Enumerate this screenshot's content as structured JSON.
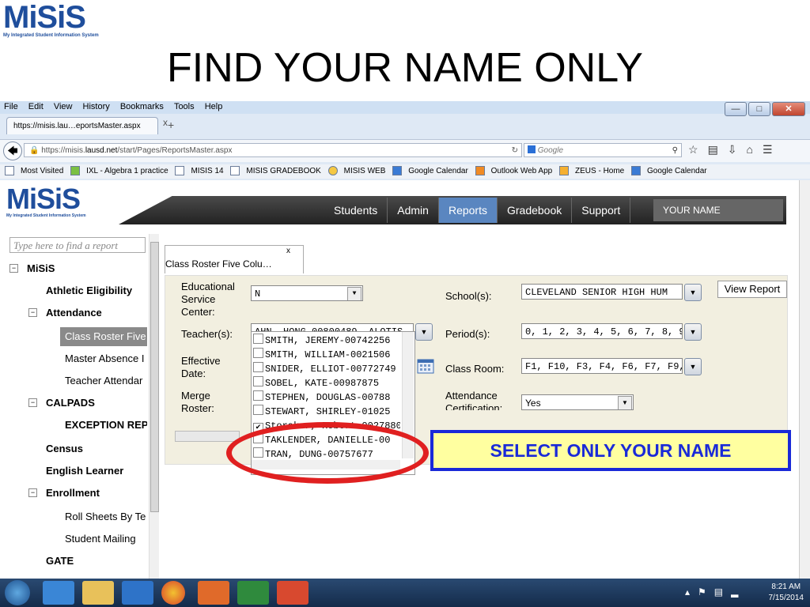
{
  "slide": {
    "logo_word": "MiSiS",
    "logo_subtitle": "My Integrated Student Information System",
    "title": "FIND YOUR NAME ONLY"
  },
  "browser": {
    "menu": [
      "File",
      "Edit",
      "View",
      "History",
      "Bookmarks",
      "Tools",
      "Help"
    ],
    "tab_title": "https://misis.lau…eportsMaster.aspx",
    "tab_close": "x",
    "new_tab": "+",
    "url_prefix": "https://misis.",
    "url_domain": "lausd.net",
    "url_path": "/start/Pages/ReportsMaster.aspx",
    "search_placeholder": "Google",
    "bookmarks": [
      {
        "label": "Most Visited",
        "icon": "bookmark-icon"
      },
      {
        "label": "IXL - Algebra 1 practice",
        "icon": "ixl-icon"
      },
      {
        "label": "MISIS 14",
        "icon": "page-icon"
      },
      {
        "label": "MISIS GRADEBOOK",
        "icon": "page-icon"
      },
      {
        "label": "MISIS WEB",
        "icon": "page-icon"
      },
      {
        "label": "Google Calendar",
        "icon": "calendar-icon"
      },
      {
        "label": "Outlook Web App",
        "icon": "outlook-icon"
      },
      {
        "label": "ZEUS - Home",
        "icon": "zeus-icon"
      },
      {
        "label": "Google Calendar",
        "icon": "calendar-icon"
      }
    ]
  },
  "app": {
    "logo_word": "MiSiS",
    "logo_subtitle": "My Integrated Student Information System",
    "nav": [
      "Students",
      "Admin",
      "Reports",
      "Gradebook",
      "Support"
    ],
    "active_nav": "Reports",
    "user_name": "YOUR NAME"
  },
  "sidebar": {
    "search_placeholder": "Type here to find a report",
    "items": [
      {
        "label": "MiSiS",
        "bold": true
      },
      {
        "label": "Athletic Eligibility",
        "bold": true
      },
      {
        "label": "Attendance",
        "bold": true
      },
      {
        "label": "Class Roster Five",
        "bold": false
      },
      {
        "label": "Master Absence I",
        "bold": false
      },
      {
        "label": "Teacher Attendar",
        "bold": false
      },
      {
        "label": "CALPADS",
        "bold": true
      },
      {
        "label": "EXCEPTION REP",
        "bold": true
      },
      {
        "label": "Census",
        "bold": true
      },
      {
        "label": "English Learner",
        "bold": true
      },
      {
        "label": "Enrollment",
        "bold": true
      },
      {
        "label": "Roll Sheets By Te",
        "bold": false
      },
      {
        "label": "Student Mailing",
        "bold": false
      },
      {
        "label": "GATE",
        "bold": true
      }
    ]
  },
  "report": {
    "tab_title": "Class Roster Five Colu…",
    "tab_close": "x",
    "view_report": "View Report",
    "fields": {
      "esc_label": "Educational Service Center:",
      "esc_value": "N",
      "school_label": "School(s):",
      "school_value": "CLEVELAND SENIOR HIGH HUM",
      "teacher_label": "Teacher(s):",
      "teacher_value": "AHN, HONG-00800489, ALOTIS",
      "period_label": "Period(s):",
      "period_value": "0, 1, 2, 3, 4, 5, 6, 7, 8, 9, 10, 1",
      "effective_label": "Effective Date:",
      "classroom_label": "Class Room:",
      "classroom_value": "F1, F10, F3, F4, F6, F7, F9, G2,",
      "merge_label": "Merge Roster:",
      "attendance_label": "Attendance Certification:",
      "attendance_value": "Yes"
    },
    "teachers": [
      {
        "name": "SMITH, JEREMY-00742256",
        "checked": false
      },
      {
        "name": "SMITH, WILLIAM-0021506",
        "checked": false
      },
      {
        "name": "SNIDER, ELLIOT-00772749",
        "checked": false
      },
      {
        "name": "SOBEL, KATE-00987875",
        "checked": false
      },
      {
        "name": "STEPHEN, DOUGLAS-00788",
        "checked": false
      },
      {
        "name": "STEWART, SHIRLEY-01025",
        "checked": false
      },
      {
        "name": "Storaker, Robert-0027880",
        "checked": true
      },
      {
        "name": "TAKLENDER, DANIELLE-00",
        "checked": false
      },
      {
        "name": "TRAN, DUNG-00757677",
        "checked": false
      }
    ]
  },
  "callout": {
    "text": "SELECT ONLY YOUR NAME",
    "border_color": "#1a2ad8",
    "fill": "#ffffa0",
    "oval_color": "#e02020"
  },
  "taskbar": {
    "time": "8:21 AM",
    "date": "7/15/2014"
  }
}
